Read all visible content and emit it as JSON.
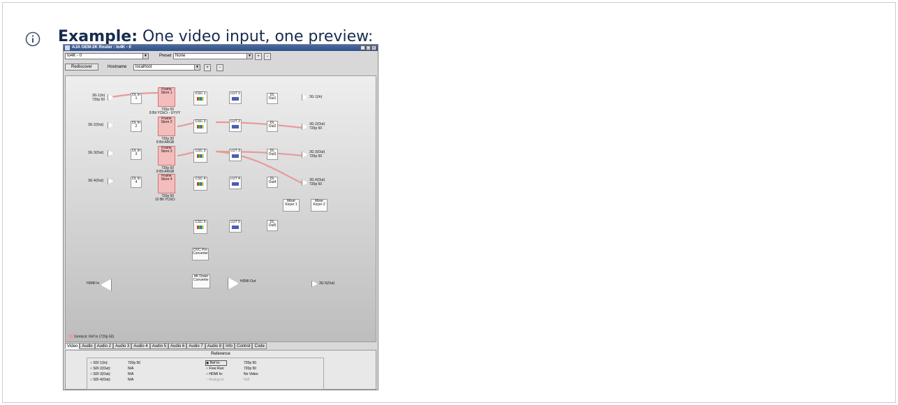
{
  "heading": {
    "label": "Example:",
    "text": " One video input, one preview:"
  },
  "window": {
    "title": "AJA OEM-2K Router : Io4K - 0",
    "buttons": [
      "_",
      "□",
      "x"
    ]
  },
  "toolbar": {
    "device": "Io4K - 0",
    "preset_label": "Preset",
    "preset_value": "None",
    "plus": "+",
    "minus": "-",
    "rediscover": "Rediscover",
    "hostname_label": "Hostname",
    "hostname_value": "localhost"
  },
  "inputs": [
    {
      "name": "3G 1(In)",
      "sub": "720p 50"
    },
    {
      "name": "3G 2(Out)",
      "sub": ""
    },
    {
      "name": "3G 3(Out)",
      "sub": ""
    },
    {
      "name": "3G 4(Out)",
      "sub": ""
    }
  ],
  "dl_in": [
    "DL In 1",
    "DL In 2",
    "DL In 3",
    "DL In 4"
  ],
  "frame_stores": [
    {
      "name": "Frame Store 1",
      "fmt": "720p 50",
      "pix": "8 Bit YCbCr - UYVY"
    },
    {
      "name": "Frame Store 2",
      "fmt": "720p 50",
      "pix": "8 Bit ARGB"
    },
    {
      "name": "Frame Store 3",
      "fmt": "720p 50",
      "pix": "8 Bit ARGB"
    },
    {
      "name": "Frame Store 4",
      "fmt": "720p 50",
      "pix": "10 Bit YCbCr"
    }
  ],
  "csc": [
    "CSC 1",
    "CSC 2",
    "CSC 3",
    "CSC 4",
    "CSC 5"
  ],
  "lut": [
    "LUT 1",
    "LUT 2",
    "LUT 3",
    "LUT 4",
    "LUT 5"
  ],
  "dl_out": [
    "DL Out1",
    "DL Out2",
    "DL Out3",
    "DL Out4",
    "DL Out5"
  ],
  "outputs": [
    {
      "name": "3G 1(In)",
      "sub": ""
    },
    {
      "name": "3G 2(Out)",
      "sub": "720p 50"
    },
    {
      "name": "3G 3(Out)",
      "sub": "720p 50"
    },
    {
      "name": "3G 4(Out)",
      "sub": "720p 50"
    },
    {
      "name": "3G 5(Out)",
      "sub": ""
    }
  ],
  "mixers": [
    "Mixer Keyer 1",
    "Mixer Keyer 2"
  ],
  "dvc": "DVC Pro Converter",
  "down": "4K Down Converter",
  "hdmi_in": "HDMI In",
  "hdmi_out": "HDMI Out",
  "genlock": "Genlock: Ref In (720p 50)",
  "tabs": [
    "Video",
    "Audio",
    "Audio 2",
    "Audio 3",
    "Audio 4",
    "Audio 5",
    "Audio 6",
    "Audio 7",
    "Audio 8",
    "Info",
    "Control",
    "Code"
  ],
  "reference": {
    "title": "Reference",
    "left": [
      {
        "label": "SDI 1(In):",
        "value": "720p 50"
      },
      {
        "label": "SDI 2(Out):",
        "value": "N/A"
      },
      {
        "label": "SDI 3(Out):",
        "value": "N/A"
      },
      {
        "label": "SDI 4(Out):",
        "value": "N/A"
      }
    ],
    "right": [
      {
        "label": "Ref In:",
        "value": "720p 50"
      },
      {
        "label": "Free Run:",
        "value": "720p 50"
      },
      {
        "label": "HDMI In:",
        "value": "No Video"
      },
      {
        "label": "Analog In:",
        "value": "N/A"
      }
    ]
  },
  "colors": {
    "wire": "#e89a9a",
    "frame_store": "#f5bcbc",
    "accent_text": "#172b4d"
  }
}
